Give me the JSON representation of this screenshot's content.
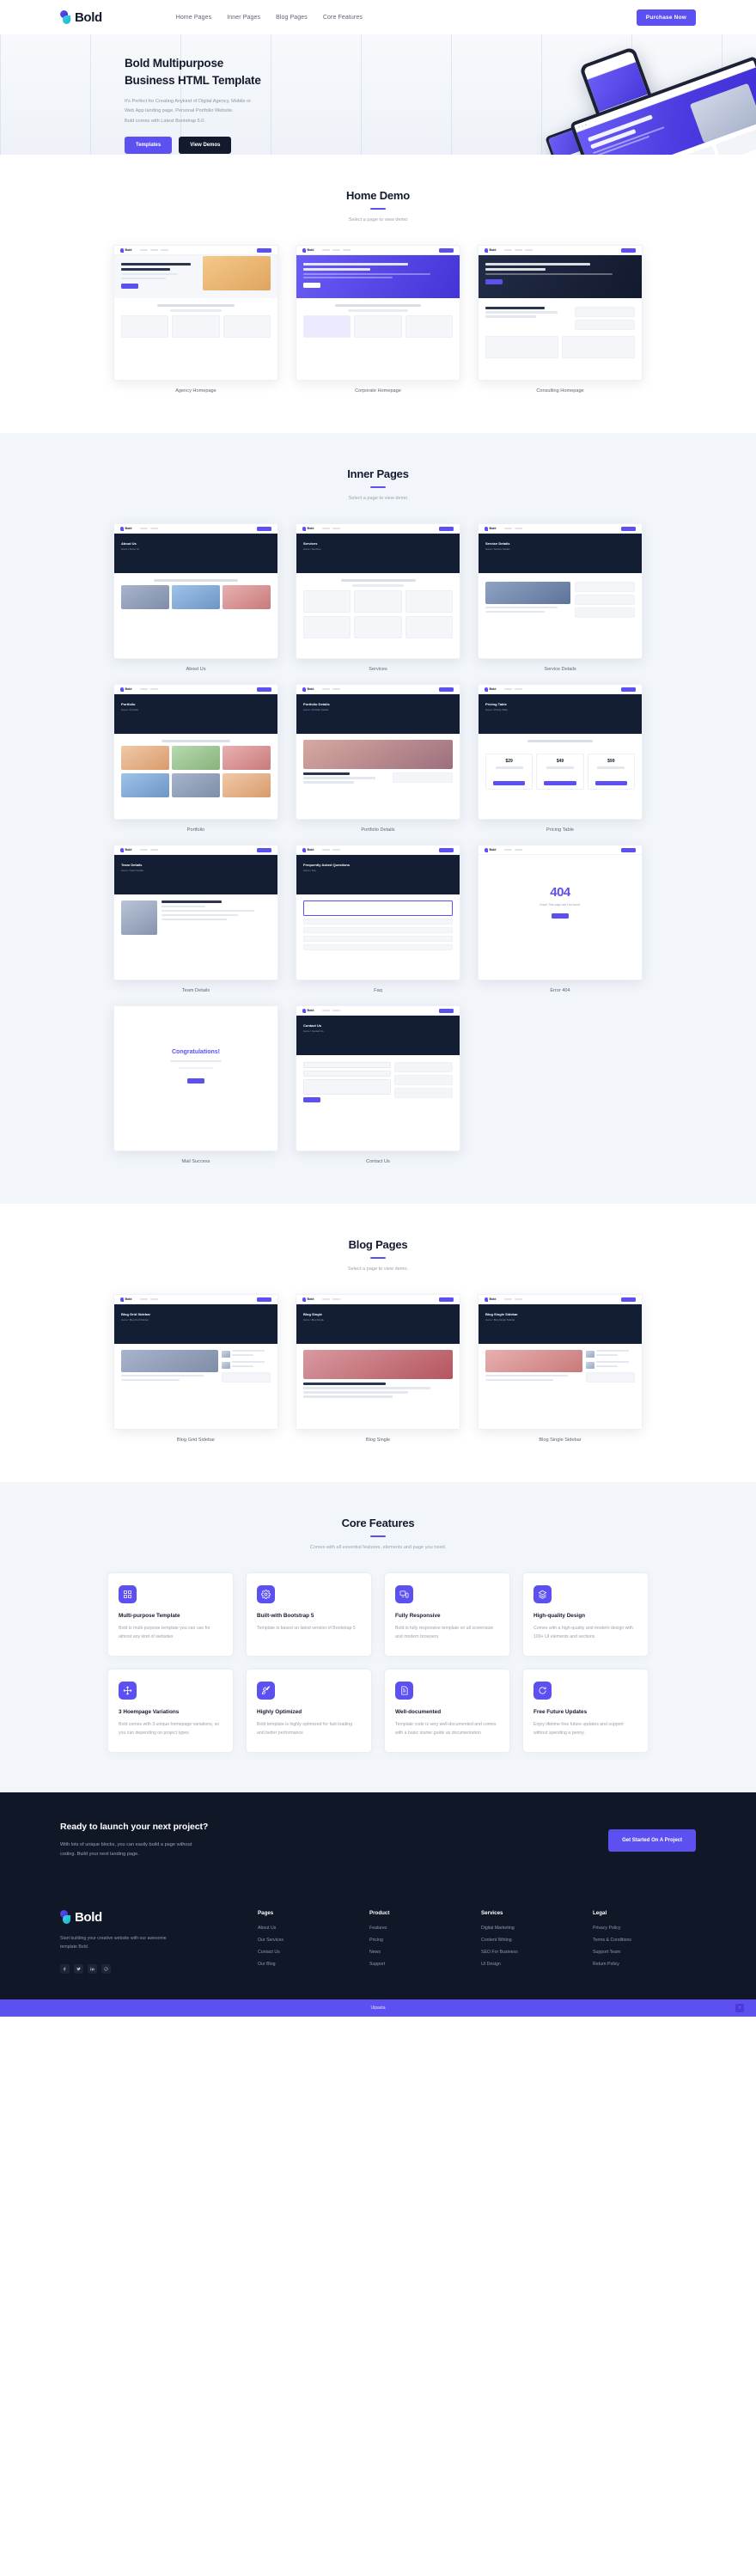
{
  "header": {
    "brand": "Bold",
    "nav": [
      {
        "label": "Home Pages"
      },
      {
        "label": "Inner Pages"
      },
      {
        "label": "Blog Pages"
      },
      {
        "label": "Core Features"
      }
    ],
    "cta": "Purchase Now"
  },
  "hero": {
    "title_line1": "Bold Multipurpose",
    "title_line2": "Business HTML Template",
    "desc_line1": "It's Perfect for Creating Anykind of Digital Agency, Mobile or",
    "desc_line2": "Web App landing page, Personal Portfolio Website.",
    "desc_line3": "Bold comes with Latest Bootstrap 5.0.",
    "btn_primary": "Templates",
    "btn_secondary": "View Demos",
    "mock_laptop_title_line1": "Shift your business",
    "mock_laptop_title_line2": "fast with bold.",
    "mock_phone_title_line1": "Helping your business",
    "mock_phone_title_line2": "build and grow"
  },
  "home_demo": {
    "title": "Home Demo",
    "subtitle": "Select a page to view demo",
    "items": [
      {
        "label": "Agency Homepage"
      },
      {
        "label": "Corporate Homepage"
      },
      {
        "label": "Consulting Homepage"
      }
    ]
  },
  "inner_pages": {
    "title": "Inner Pages",
    "subtitle": "Select a page to view demo",
    "items": [
      {
        "label": "About Us"
      },
      {
        "label": "Services"
      },
      {
        "label": "Service Details"
      },
      {
        "label": "Portfolio"
      },
      {
        "label": "Portfolio Details"
      },
      {
        "label": "Pricing Table"
      },
      {
        "label": "Team Details"
      },
      {
        "label": "Faq"
      },
      {
        "label": "Error 404"
      },
      {
        "label": "Mail Success"
      },
      {
        "label": "Contact Us"
      }
    ],
    "error_number": "404",
    "error_caption": "Oops! This page can't be found.",
    "success_text": "Congratulations!",
    "thumb_about_title": "About Us",
    "thumb_services_title": "Services",
    "thumb_service_details_title": "Service Details",
    "thumb_portfolio_title": "Portfolio",
    "thumb_portfolio_details_title": "Portfolio Details",
    "thumb_pricing_title": "Pricing Table",
    "thumb_team_title": "Team Details",
    "thumb_faq_title": "Frequently Asked Questions",
    "thumb_contact_title": "Contact Us"
  },
  "blog_pages": {
    "title": "Blog Pages",
    "subtitle": "Select a page to view demo.",
    "items": [
      {
        "label": "Blog Grid Sidebar"
      },
      {
        "label": "Blog Single"
      },
      {
        "label": "Blog Single Sidebar"
      }
    ],
    "thumb_grid_title": "Blog Grid Sidebar",
    "thumb_single_title": "Blog Single",
    "thumb_single_sidebar_title": "Blog Single Sidebar"
  },
  "core_features": {
    "title": "Core Features",
    "subtitle": "Comes with all essential features, elements and page you need.",
    "cards": [
      {
        "icon": "grid-icon",
        "title": "Multi-purpose Template",
        "desc": "Bold is multi-purpose template you can use for almost any kind of websites"
      },
      {
        "icon": "gear-icon",
        "title": "Built-with Bootstrap 5",
        "desc": "Template is based on latest version of Bootstrap 5"
      },
      {
        "icon": "responsive-devices-icon",
        "title": "Fully Responsive",
        "desc": "Bold is fully responsive template on all screensize and modern browsers"
      },
      {
        "icon": "layers-icon",
        "title": "High-quality Design",
        "desc": "Comes with a high-quality and modern design with 100+ UI elements and sections"
      },
      {
        "icon": "move-arrows-icon",
        "title": "3 Hoempage Variations",
        "desc": "Bold comes with 3 unique homepage variations, so you can depending on project types"
      },
      {
        "icon": "rocket-icon",
        "title": "Highly Optimized",
        "desc": "Bold template is highly optimized for fast loading and better performance"
      },
      {
        "icon": "document-icon",
        "title": "Well-documented",
        "desc": "Template code is very well-documented and comes with a basic starter guide as documentation"
      },
      {
        "icon": "refresh-icon",
        "title": "Free Future Updates",
        "desc": "Enjoy lifetime free future updates and support without spending a penny."
      }
    ]
  },
  "cta": {
    "title": "Ready to launch your next project?",
    "desc_line1": "With lots of unique blocks, you can easily build a page without",
    "desc_line2": "coding. Build your next landing page.",
    "button": "Get Started On A Project"
  },
  "footer": {
    "brand": "Bold",
    "about": "Start building your creative website with our awesome template Bold.",
    "social": [
      {
        "name": "facebook-icon"
      },
      {
        "name": "twitter-icon"
      },
      {
        "name": "linkedin-icon"
      },
      {
        "name": "dribbble-icon"
      }
    ],
    "columns": [
      {
        "title": "Pages",
        "links": [
          {
            "label": "About Us"
          },
          {
            "label": "Our Services"
          },
          {
            "label": "Contact Us"
          },
          {
            "label": "Our Blog"
          }
        ]
      },
      {
        "title": "Product",
        "links": [
          {
            "label": "Features"
          },
          {
            "label": "Pricing"
          },
          {
            "label": "News"
          },
          {
            "label": "Support"
          }
        ]
      },
      {
        "title": "Services",
        "links": [
          {
            "label": "Digital Marketing"
          },
          {
            "label": "Content Writing"
          },
          {
            "label": "SEO For Business"
          },
          {
            "label": "UI Design"
          }
        ]
      },
      {
        "title": "Legal",
        "links": [
          {
            "label": "Privacy Policy"
          },
          {
            "label": "Terms & Conditions"
          },
          {
            "label": "Support Team"
          },
          {
            "label": "Return Policy"
          }
        ]
      }
    ]
  },
  "bottom": {
    "text": "Uipasta",
    "scroll_top": "↑"
  },
  "colors": {
    "accent": "#5d50f0",
    "dark": "#101828",
    "navy": "#131a2e",
    "light_bg": "#f2f6fa",
    "muted_text": "#99a1b2"
  }
}
